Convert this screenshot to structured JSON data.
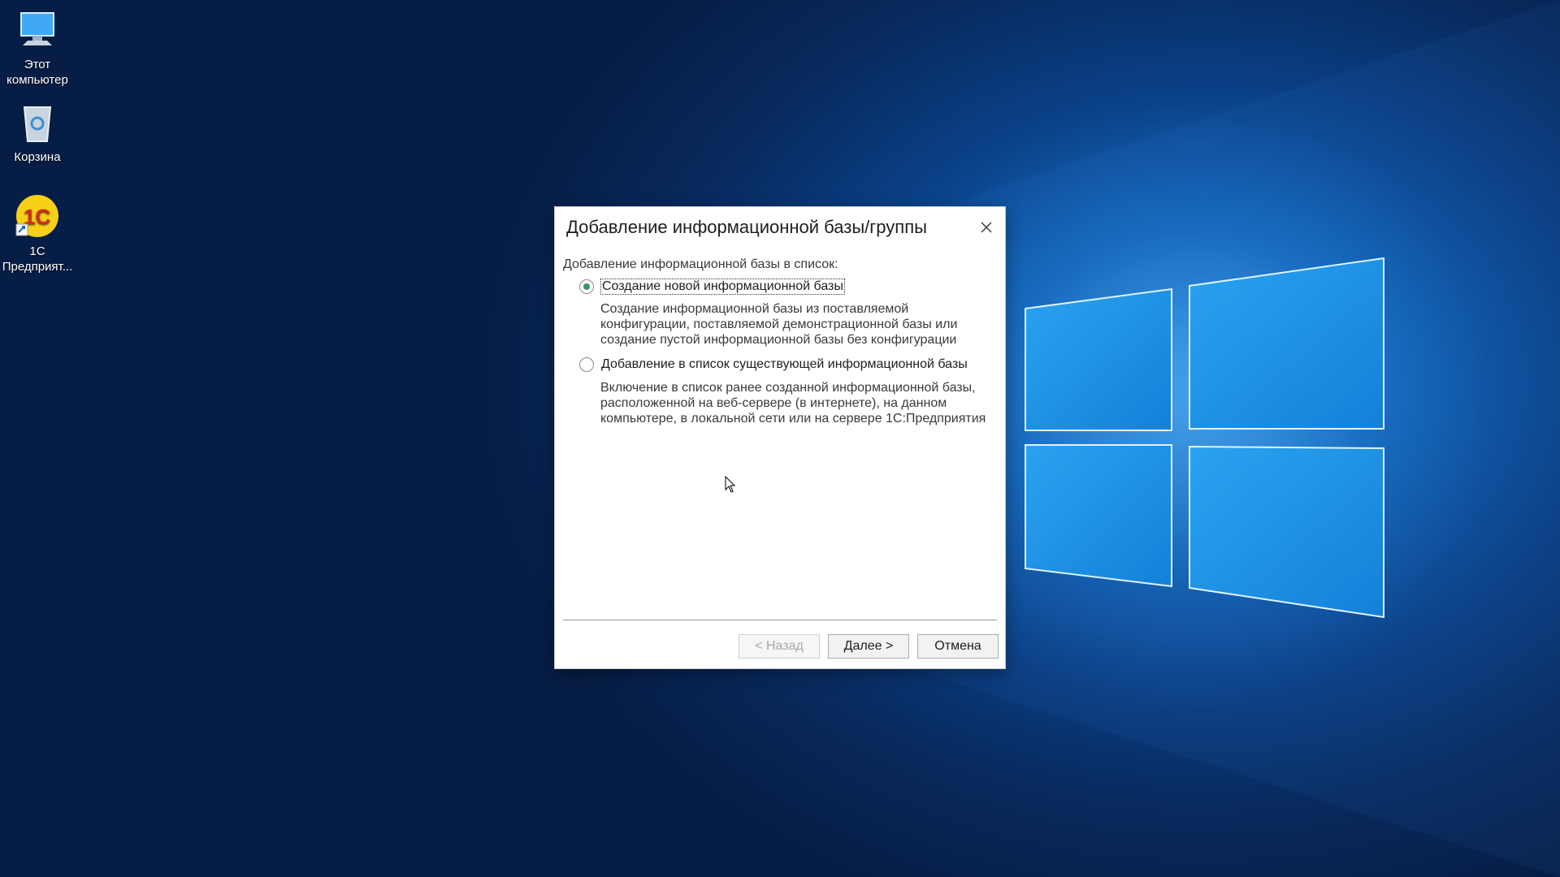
{
  "desktop": {
    "icons": [
      {
        "label": "Этот компьютер"
      },
      {
        "label": "Корзина"
      },
      {
        "label": "1С Предприят..."
      }
    ]
  },
  "dialog": {
    "title": "Добавление информационной базы/группы",
    "section_label": "Добавление информационной базы в список:",
    "options": [
      {
        "label": "Создание новой информационной базы",
        "selected": true,
        "description": "Создание информационной базы из поставляемой конфигурации, поставляемой демонстрационной базы или создание пустой информационной базы без конфигурации"
      },
      {
        "label": "Добавление в список существующей информационной базы",
        "selected": false,
        "description": "Включение в список ранее созданной информационной базы, расположенной на веб-сервере (в интернете), на данном компьютере,  в локальной сети или на сервере 1С:Предприятия"
      }
    ],
    "buttons": {
      "back": "< Назад",
      "next": "Далее >",
      "cancel": "Отмена"
    }
  },
  "colors": {
    "radio_selected": "#2e9c5f",
    "desktop_blue": "#0a3f85"
  }
}
